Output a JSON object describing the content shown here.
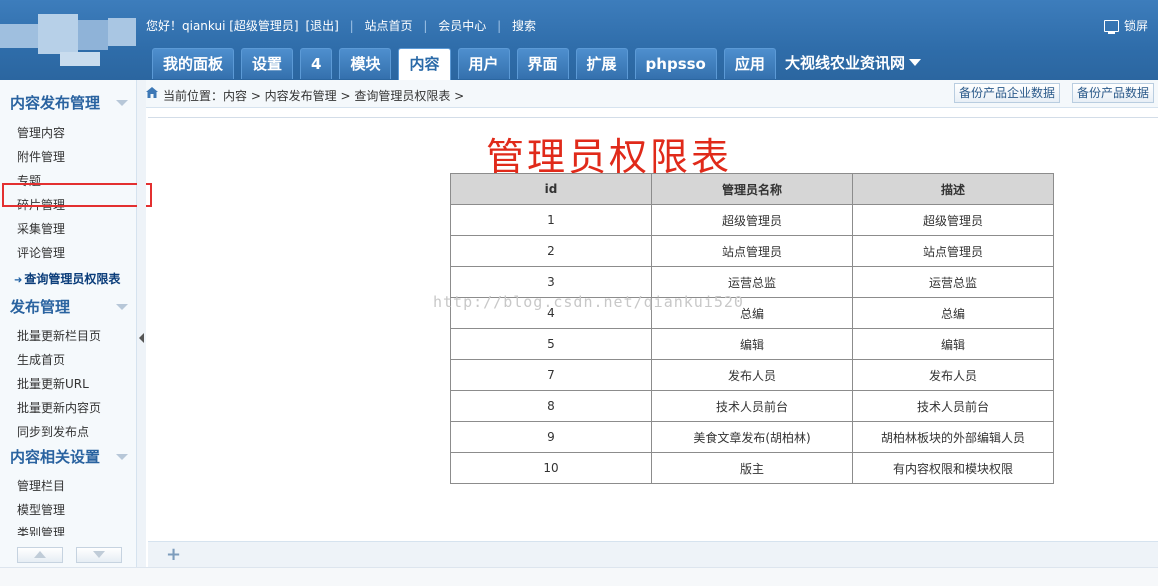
{
  "colors": {
    "header": "#2f6daa",
    "title_red": "#e02a1a",
    "nav_blue": "#2a63a0",
    "highlight": "#e33030"
  },
  "header": {
    "greeting": "您好！qiankui [超级管理员]",
    "logout": "[退出]",
    "links": [
      "站点首页",
      "会员中心",
      "搜索"
    ],
    "lock": "锁屏",
    "tabs": [
      "我的面板",
      "设置",
      "4",
      "模块",
      "内容",
      "用户",
      "界面",
      "扩展",
      "phpsso",
      "应用"
    ],
    "active_tab": "内容",
    "site_name": "大视线农业资讯网"
  },
  "sidebar": {
    "sections": [
      {
        "title": "内容发布管理",
        "items": [
          "管理内容",
          "附件管理",
          "专题",
          "碎片管理",
          "采集管理",
          "评论管理",
          "查询管理员权限表"
        ]
      },
      {
        "title": "发布管理",
        "items": [
          "批量更新栏目页",
          "生成首页",
          "批量更新URL",
          "批量更新内容页",
          "同步到发布点"
        ]
      },
      {
        "title": "内容相关设置",
        "items": [
          "管理栏目",
          "模型管理",
          "类别管理"
        ]
      }
    ],
    "current_item": "查询管理员权限表"
  },
  "breadcrumb": {
    "text": "当前位置：内容 > 内容发布管理 > 查询管理员权限表 >",
    "buttons": [
      "备份产品企业数据",
      "备份产品数据"
    ]
  },
  "main": {
    "title": "管理员权限表",
    "columns": [
      "id",
      "管理员名称",
      "描述"
    ],
    "rows": [
      [
        "1",
        "超级管理员",
        "超级管理员"
      ],
      [
        "2",
        "站点管理员",
        "站点管理员"
      ],
      [
        "3",
        "运营总监",
        "运营总监"
      ],
      [
        "4",
        "总编",
        "总编"
      ],
      [
        "5",
        "编辑",
        "编辑"
      ],
      [
        "7",
        "发布人员",
        "发布人员"
      ],
      [
        "8",
        "技术人员前台",
        "技术人员前台"
      ],
      [
        "9",
        "美食文章发布(胡柏林)",
        "胡柏林板块的外部编辑人员"
      ],
      [
        "10",
        "版主",
        "有内容权限和模块权限"
      ]
    ],
    "watermark": "http://blog.csdn.net/qiankui520"
  },
  "icons": {
    "home": "home-icon",
    "lock": "monitor-icon",
    "add": "plus-icon"
  }
}
